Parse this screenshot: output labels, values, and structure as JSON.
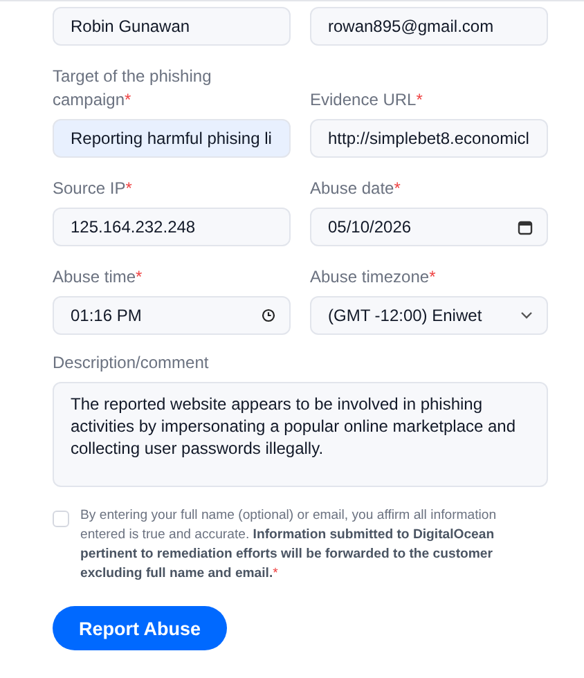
{
  "fields": [
    {
      "kind": "text",
      "value": "Robin Gunawan",
      "highlighted": false
    },
    {
      "kind": "text",
      "value": "rowan895@gmail.com",
      "highlighted": false
    },
    {
      "kind": "text",
      "label": "Target of the phishing campaign",
      "mark": "*",
      "value": "Reporting harmful phising li",
      "highlighted": true
    },
    {
      "kind": "text",
      "label": "Evidence URL",
      "mark": "*",
      "value": "http://simplebet8.economicl",
      "highlighted": false
    },
    {
      "kind": "text",
      "label": "Source IP",
      "mark": "*",
      "value": "125.164.232.248",
      "highlighted": false
    },
    {
      "kind": "date",
      "label": "Abuse date",
      "mark": "*",
      "value": "05/10/2026",
      "highlighted": false
    },
    {
      "kind": "time",
      "label": "Abuse time",
      "mark": "*",
      "value": "01:16 PM",
      "highlighted": false
    },
    {
      "kind": "select",
      "label": "Abuse timezone",
      "mark": "*",
      "value": "(GMT -12:00) Eniwet",
      "highlighted": false
    }
  ],
  "description": {
    "label": "Description/comment",
    "value": "The reported website appears to be involved in phishing activities by impersonating a popular online marketplace and collecting user passwords illegally."
  },
  "consent": {
    "checked": false,
    "text": "By entering your full name (optional) or email, you affirm all information entered is true and accurate. **Information submitted to DigitalOcean pertinent to remediation efforts will be forwarded to the customer excluding full name and email.**",
    "mark": "*"
  },
  "submit": "Report Abuse"
}
